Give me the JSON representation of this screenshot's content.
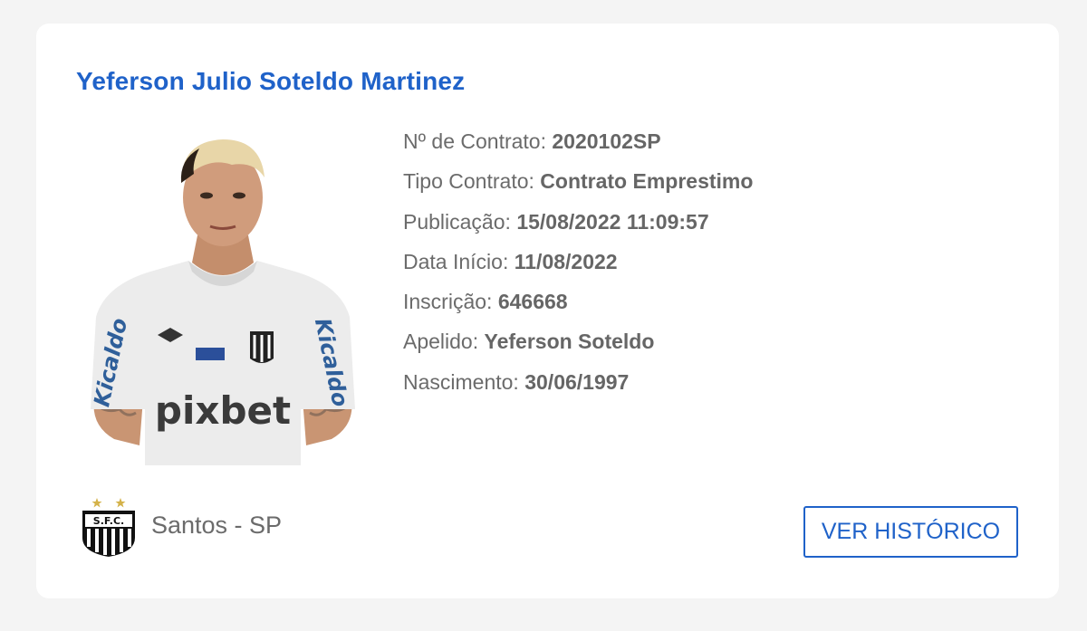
{
  "player": {
    "name": "Yeferson Julio Soteldo Martinez",
    "photo_icon": "player-photo"
  },
  "contract": {
    "fields": [
      {
        "label": "Nº de Contrato:",
        "value": "2020102SP"
      },
      {
        "label": "Tipo Contrato:",
        "value": "Contrato Emprestimo"
      },
      {
        "label": "Publicação:",
        "value": "15/08/2022 11:09:57"
      },
      {
        "label": "Data Início:",
        "value": "11/08/2022"
      },
      {
        "label": "Inscrição:",
        "value": "646668"
      },
      {
        "label": "Apelido:",
        "value": "Yeferson Soteldo"
      },
      {
        "label": "Nascimento:",
        "value": "30/06/1997"
      }
    ]
  },
  "shirt": {
    "sponsor_main": "pixbet",
    "sponsor_sleeve": "Kicaldo"
  },
  "club": {
    "name": "Santos - SP",
    "badge_icon": "santos-badge-icon"
  },
  "actions": {
    "history_label": "VER HISTÓRICO"
  },
  "colors": {
    "accent": "#1f62c9",
    "text": "#6b6b6b",
    "background": "#f4f4f4",
    "card": "#ffffff"
  }
}
